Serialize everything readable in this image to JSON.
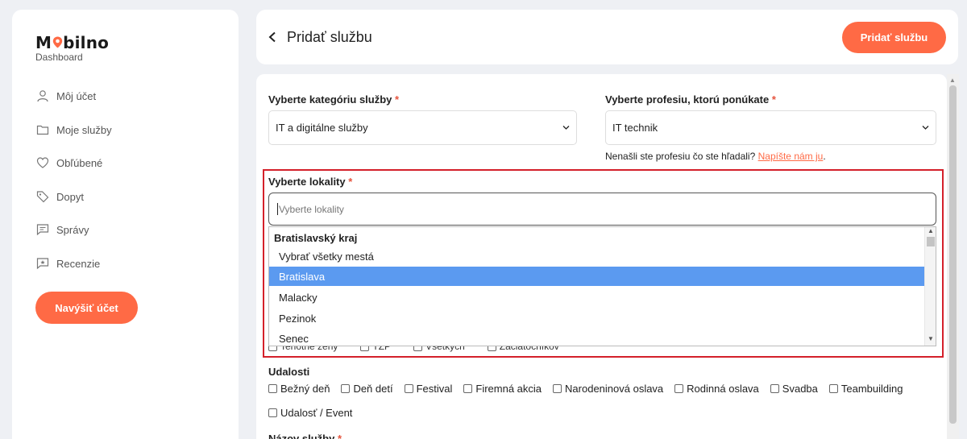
{
  "brand": {
    "logo_prefix": "M",
    "logo_suffix": "bilno",
    "subtitle": "Dashboard",
    "accent": "#ff6a45"
  },
  "sidebar": {
    "items": [
      {
        "label": "Môj účet",
        "icon": "user-icon"
      },
      {
        "label": "Moje služby",
        "icon": "folder-icon"
      },
      {
        "label": "Obľúbené",
        "icon": "heart-icon"
      },
      {
        "label": "Dopyt",
        "icon": "tag-icon"
      },
      {
        "label": "Správy",
        "icon": "message-icon"
      },
      {
        "label": "Recenzie",
        "icon": "review-icon"
      }
    ],
    "upgrade_label": "Navýšiť účet"
  },
  "header": {
    "title": "Pridať službu",
    "add_button": "Pridať službu"
  },
  "form": {
    "category_label": "Vyberte kategóriu služby",
    "category_value": "IT a digitálne služby",
    "profession_label": "Vyberte profesiu, ktorú ponúkate",
    "profession_value": "IT technik",
    "hint_text": "Nenašli ste profesiu čo ste hľadali?",
    "hint_link": "Napíšte nám ju",
    "hint_end": ".",
    "required_mark": "*",
    "location_label": "Vyberte lokality",
    "location_placeholder": "Vyberte lokality",
    "dropdown": {
      "group": "Bratislavský kraj",
      "options": [
        "Vybrať všetky mestá",
        "Bratislava",
        "Malacky",
        "Pezinok",
        "Senec"
      ],
      "selected": "Bratislava"
    },
    "hidden_checkboxes": [
      "Tehotné ženy",
      "ŤZP",
      "Všetkých",
      "Začiatočníkov"
    ],
    "events_label": "Udalosti",
    "events": [
      "Bežný deň",
      "Deň detí",
      "Festival",
      "Firemná akcia",
      "Narodeninová oslava",
      "Rodinná oslava",
      "Svadba",
      "Teambuilding",
      "Udalosť / Event"
    ],
    "service_name_label": "Názov služby"
  }
}
